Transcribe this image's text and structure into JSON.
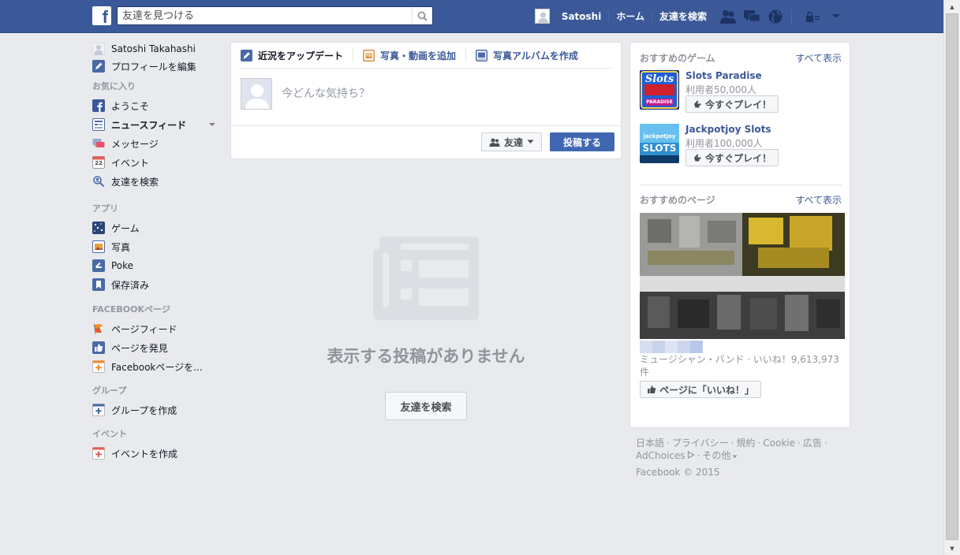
{
  "topbar": {
    "logo_letter": "f",
    "search_placeholder": "友達を見つける",
    "user_name": "Satoshi",
    "home": "ホーム",
    "find_friends": "友達を検索"
  },
  "leftnav": {
    "profile_name": "Satoshi Takahashi",
    "edit_profile": "プロフィールを編集",
    "favorites_title": "お気に入り",
    "favorites": [
      "ようこそ",
      "ニュースフィード",
      "メッセージ",
      "イベント",
      "友達を検索"
    ],
    "events_icon_day": "22",
    "apps_title": "アプリ",
    "apps": [
      "ゲーム",
      "写真",
      "Poke",
      "保存済み"
    ],
    "pages_title": "FACEBOOKページ",
    "pages": [
      "ページフィード",
      "ページを発見",
      "Facebookページを..."
    ],
    "groups_title": "グループ",
    "groups": [
      "グループを作成"
    ],
    "events_title": "イベント",
    "events": [
      "イベントを作成"
    ]
  },
  "composer": {
    "tab_status": "近況をアップデート",
    "tab_photo": "写真・動画を追加",
    "tab_album": "写真アルバムを作成",
    "placeholder": "今どんな気持ち？",
    "audience": "友達",
    "post": "投稿する"
  },
  "feed": {
    "empty_message": "表示する投稿がありません",
    "find_friends_button": "友達を検索"
  },
  "rightcol": {
    "games_title": "おすすめのゲーム",
    "see_all": "すべて表示",
    "games": [
      {
        "name": "Slots Paradise",
        "users": "利用者50,000人",
        "play": "今すぐプレイ！",
        "thumb_word": "Slots",
        "thumb_sub": "PARADISE"
      },
      {
        "name": "Jackpotjoy Slots",
        "users": "利用者100,000人",
        "play": "今すぐプレイ！",
        "thumb_word": "SLOTS",
        "thumb_sub": "jackpotjoy"
      }
    ],
    "pages_title": "おすすめのページ",
    "page_meta": "ミュージシャン・バンド · いいね！9,613,973件",
    "like_page": "ページに「いいね！」"
  },
  "footer": {
    "links": [
      "日本語",
      "プライバシー",
      "規約",
      "Cookie",
      "広告",
      "AdChoices",
      "その他"
    ],
    "copyright": "Facebook © 2015"
  },
  "colors": {
    "brand_blue": "#3b5998",
    "background": "#e9eaed",
    "muted_text": "#90949c"
  }
}
